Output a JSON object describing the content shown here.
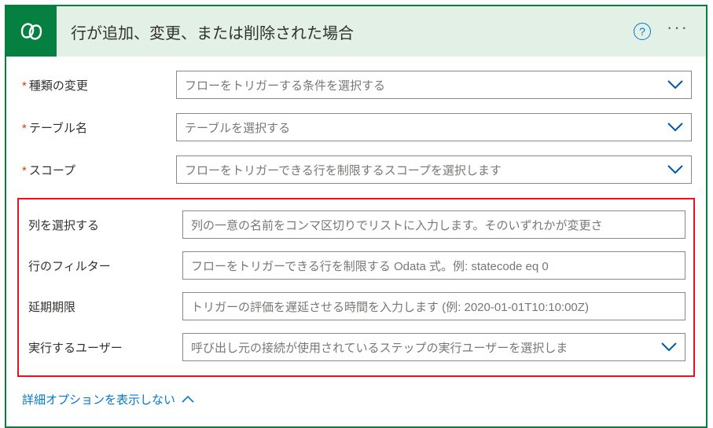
{
  "header": {
    "title": "行が追加、変更、または削除された場合"
  },
  "fields": {
    "changeType": {
      "label": "種類の変更",
      "placeholder": "フローをトリガーする条件を選択する"
    },
    "tableName": {
      "label": "テーブル名",
      "placeholder": "テーブルを選択する"
    },
    "scope": {
      "label": "スコープ",
      "placeholder": "フローをトリガーできる行を制限するスコープを選択します"
    },
    "selectColumns": {
      "label": "列を選択する",
      "placeholder": "列の一意の名前をコンマ区切りでリストに入力します。そのいずれかが変更さ"
    },
    "filterRows": {
      "label": "行のフィルター",
      "placeholder": "フローをトリガーできる行を制限する Odata 式。例: statecode eq 0"
    },
    "delayUntil": {
      "label": "延期期限",
      "placeholder": "トリガーの評価を遅延させる時間を入力します (例: 2020-01-01T10:10:00Z)"
    },
    "runAs": {
      "label": "実行するユーザー",
      "placeholder": "呼び出し元の接続が使用されているステップの実行ユーザーを選択しま"
    }
  },
  "footer": {
    "toggleLabel": "詳細オプションを表示しない"
  },
  "icons": {
    "helpGlyph": "?",
    "ellipsisGlyph": "···"
  }
}
